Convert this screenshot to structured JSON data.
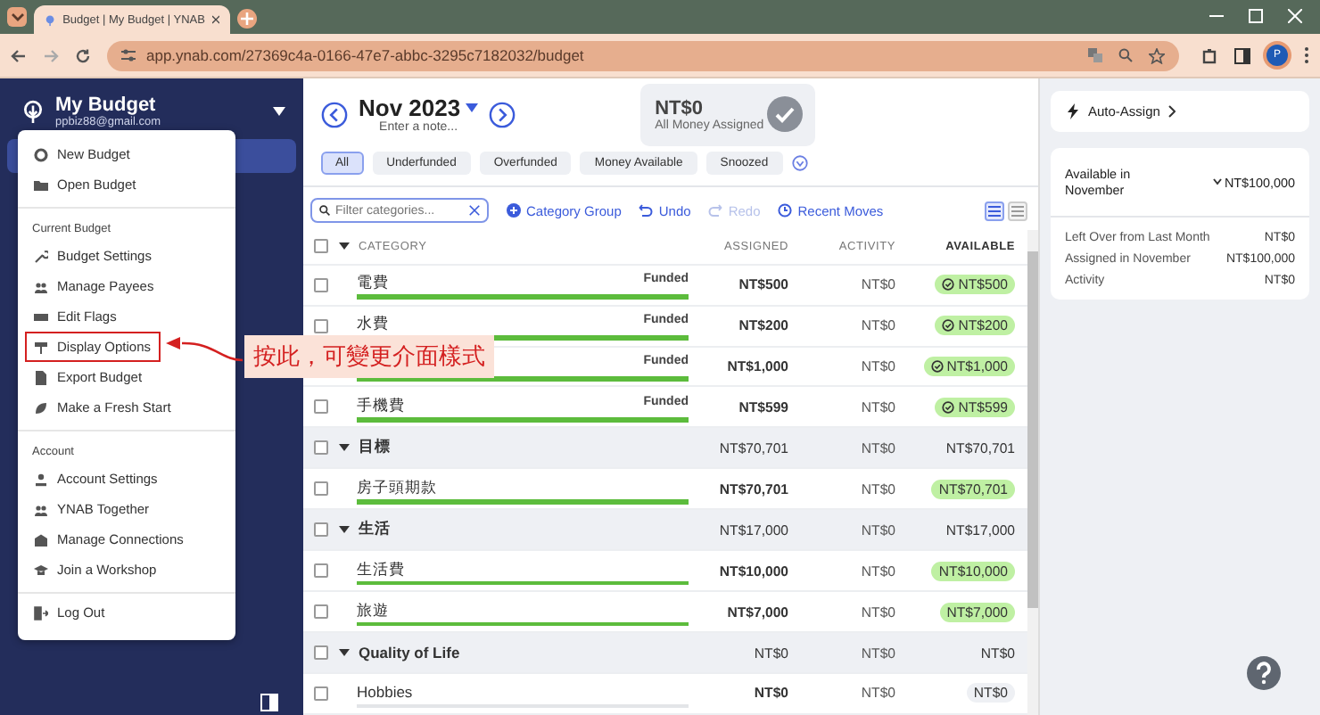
{
  "browser": {
    "tab_title": "Budget | My Budget | YNAB",
    "url": "app.ynab.com/27369c4a-0166-47e7-abbc-3295c7182032/budget",
    "profile_initial": "P"
  },
  "sidebar": {
    "budget_name": "My Budget",
    "email": "ppbiz88@gmail.com"
  },
  "menu": {
    "sections": [
      {
        "items": [
          {
            "label": "New Budget",
            "annotated": false
          },
          {
            "label": "Open Budget",
            "annotated": false
          }
        ]
      },
      {
        "heading": "Current Budget",
        "items": [
          {
            "label": "Budget Settings",
            "annotated": false
          },
          {
            "label": "Manage Payees",
            "annotated": false
          },
          {
            "label": "Edit Flags",
            "annotated": false
          },
          {
            "label": "Display Options",
            "annotated": true
          },
          {
            "label": "Export Budget",
            "annotated": false
          },
          {
            "label": "Make a Fresh Start",
            "annotated": false
          }
        ]
      },
      {
        "heading": "Account",
        "items": [
          {
            "label": "Account Settings",
            "annotated": false
          },
          {
            "label": "YNAB Together",
            "annotated": false
          },
          {
            "label": "Manage Connections",
            "annotated": false
          },
          {
            "label": "Join a Workshop",
            "annotated": false
          }
        ]
      },
      {
        "items": [
          {
            "label": "Log Out",
            "annotated": false
          }
        ]
      }
    ]
  },
  "annotation": {
    "label": "按此，可變更介面樣式"
  },
  "header": {
    "month": "Nov 2023",
    "note_placeholder": "Enter a note...",
    "ready_amount": "NT$0",
    "ready_label": "All Money Assigned"
  },
  "filters": [
    {
      "label": "All",
      "selected": true
    },
    {
      "label": "Underfunded",
      "selected": false
    },
    {
      "label": "Overfunded",
      "selected": false
    },
    {
      "label": "Money Available",
      "selected": false
    },
    {
      "label": "Snoozed",
      "selected": false
    }
  ],
  "toolbar": {
    "filter_placeholder": "Filter categories...",
    "actions": [
      {
        "label": "Category Group",
        "disabled": false
      },
      {
        "label": "Undo",
        "disabled": false
      },
      {
        "label": "Redo",
        "disabled": true
      },
      {
        "label": "Recent Moves",
        "disabled": false
      }
    ],
    "views": [
      {
        "selected": true
      },
      {
        "selected": false
      }
    ]
  },
  "table": {
    "columns": [
      "CATEGORY",
      "ASSIGNED",
      "ACTIVITY",
      "AVAILABLE"
    ],
    "all_checked": false,
    "rows": [
      {
        "kind": "category",
        "checked": false,
        "name": "電費",
        "status": "Funded",
        "level": 1,
        "assigned": "NT$500",
        "activity": "NT$0",
        "available": "NT$500",
        "color": "#bff0a3"
      },
      {
        "kind": "category",
        "checked": false,
        "name": "水費",
        "status": "Funded",
        "level": 1,
        "assigned": "NT$200",
        "activity": "NT$0",
        "available": "NT$200",
        "color": "#bff0a3"
      },
      {
        "kind": "category",
        "status": "Funded",
        "level": 1,
        "assigned": "NT$1,000",
        "activity": "NT$0",
        "available": "NT$1,000",
        "color": "#bff0a3"
      },
      {
        "kind": "category",
        "checked": false,
        "name": "手機費",
        "status": "Funded",
        "level": 1,
        "assigned": "NT$599",
        "activity": "NT$0",
        "available": "NT$599",
        "color": "#bff0a3"
      },
      {
        "kind": "group",
        "checked": false,
        "name": "目標",
        "assigned": "NT$70,701",
        "activity": "NT$0",
        "available": "NT$70,701"
      },
      {
        "kind": "category",
        "checked": false,
        "name": "房子頭期款",
        "level": 1,
        "assigned": "NT$70,701",
        "activity": "NT$0",
        "available": "NT$70,701",
        "color": "#bff0a3"
      },
      {
        "kind": "group",
        "checked": false,
        "name": "生活",
        "assigned": "NT$17,000",
        "activity": "NT$0",
        "available": "NT$17,000"
      },
      {
        "kind": "category",
        "checked": false,
        "name": "生活費",
        "level": 1,
        "assigned": "NT$10,000",
        "activity": "NT$0",
        "available": "NT$10,000",
        "color": "#bff0a3"
      },
      {
        "kind": "category",
        "checked": false,
        "name": "旅遊",
        "level": 1,
        "assigned": "NT$7,000",
        "activity": "NT$0",
        "available": "NT$7,000",
        "color": "#bff0a3"
      },
      {
        "kind": "group",
        "checked": false,
        "name": "Quality of Life",
        "assigned": "NT$0",
        "activity": "NT$0",
        "available": "NT$0"
      },
      {
        "kind": "category",
        "checked": false,
        "name": "Hobbies",
        "level": 0,
        "assigned": "NT$0",
        "activity": "NT$0",
        "available": "NT$0",
        "color": "#eef0f4"
      }
    ]
  },
  "inspector": {
    "auto_assign": "Auto-Assign",
    "available_label": "Available in November",
    "available_value": "NT$100,000",
    "breakdown": [
      {
        "label": "Left Over from Last Month",
        "value": "NT$0"
      },
      {
        "label": "Assigned in November",
        "value": "NT$100,000"
      },
      {
        "label": "Activity",
        "value": "NT$0"
      }
    ]
  }
}
